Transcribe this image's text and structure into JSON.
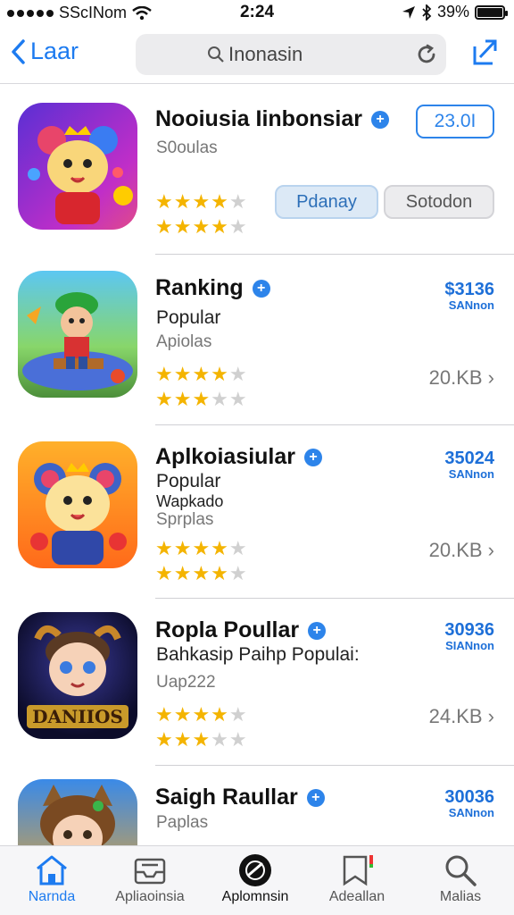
{
  "status": {
    "carrier": "SScINom",
    "time": "2:24",
    "battery": "39%"
  },
  "nav": {
    "back_label": "Laar",
    "search_placeholder": "Inonasin"
  },
  "apps": [
    {
      "title": "Nooiusia Iinbonsiar",
      "subtitle": "S0oulas",
      "rating": 4,
      "rating2": 4,
      "price": "23.0I",
      "buttons": [
        "Pdanay",
        "Sotodon"
      ]
    },
    {
      "title": "Ranking",
      "subtitle": "Popular",
      "subtitle2": "Apiolas",
      "rating": 4,
      "rating2": 3,
      "price": "$3136",
      "price_note": "SANnon",
      "size": "20.KB"
    },
    {
      "title": "Aplkoiasiular",
      "subtitle": "Popular",
      "subtitle2": "Wapkado",
      "subtitle3": "Sprplas",
      "rating": 4,
      "rating2": 4,
      "price": "35024",
      "price_note": "SANnon",
      "size": "20.KB"
    },
    {
      "title": "Ropla Poullar",
      "subtitle": "Bahkasip Paihp Populai:",
      "subtitle2": "Uap222",
      "rating": 4,
      "rating2": 3,
      "price": "30936",
      "price_note": "SIANnon",
      "size": "24.KB"
    },
    {
      "title": "Saigh Raullar",
      "subtitle2": "Paplas",
      "price": "30036",
      "price_note": "SANnon"
    }
  ],
  "tabs": [
    {
      "label": "Narnda",
      "icon": "home-icon",
      "active": true
    },
    {
      "label": "Apliaoinsia",
      "icon": "inbox-icon"
    },
    {
      "label": "Aplomnsin",
      "icon": "compass-icon"
    },
    {
      "label": "Adeallan",
      "icon": "bookmark-icon"
    },
    {
      "label": "Malias",
      "icon": "search-icon"
    }
  ],
  "colors": {
    "accent": "#1d7bf0",
    "star": "#f4b400",
    "price": "#1d6fd8"
  }
}
